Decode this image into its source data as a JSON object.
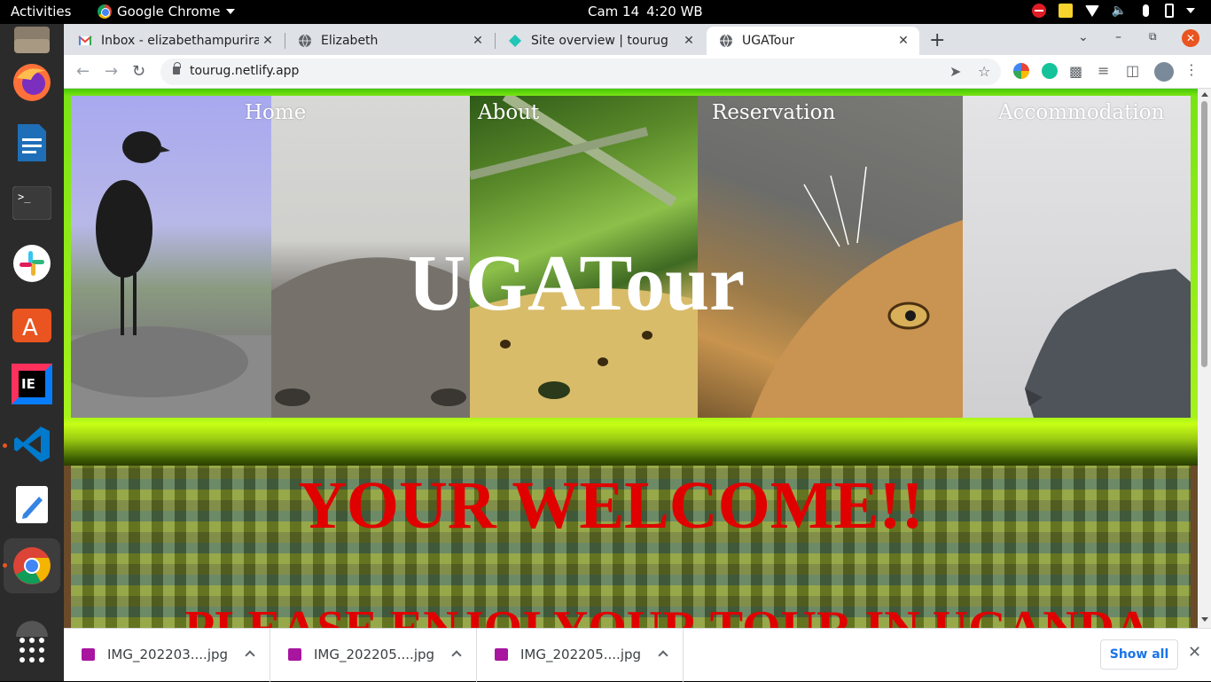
{
  "topbar": {
    "activities": "Activities",
    "app_name": "Google Chrome",
    "day": "Cam 14",
    "time": "4:20 WB"
  },
  "dock": {
    "apps": [
      "files",
      "firefox",
      "libreoffice-writer",
      "terminal",
      "slack",
      "app-center",
      "intellij-idea",
      "vscode",
      "text-editor",
      "chrome",
      "more"
    ]
  },
  "tabs": [
    {
      "label": "Inbox - elizabethampurira",
      "icon": "gmail-icon"
    },
    {
      "label": "Elizabeth",
      "icon": "globe-icon"
    },
    {
      "label": "Site overview | tourug",
      "icon": "netlify-icon"
    },
    {
      "label": "UGATour",
      "icon": "globe-icon",
      "active": true
    }
  ],
  "toolbar": {
    "url": "tourug.netlify.app"
  },
  "site": {
    "nav": [
      "Home",
      "About",
      "Reservation",
      "Accommodation"
    ],
    "brand": "UGATour",
    "welcome": "YOUR WELCOME!!",
    "subtitle": "PLEASE ENJOI YOUR TOUR IN UGANDA"
  },
  "downloads": {
    "items": [
      "IMG_202203....jpg",
      "IMG_202205....jpg",
      "IMG_202205....jpg"
    ],
    "show_all": "Show all"
  },
  "colors": {
    "accent_green": "#a6f21b",
    "welcome_red": "#e00000",
    "ubuntu_orange": "#e95420"
  }
}
